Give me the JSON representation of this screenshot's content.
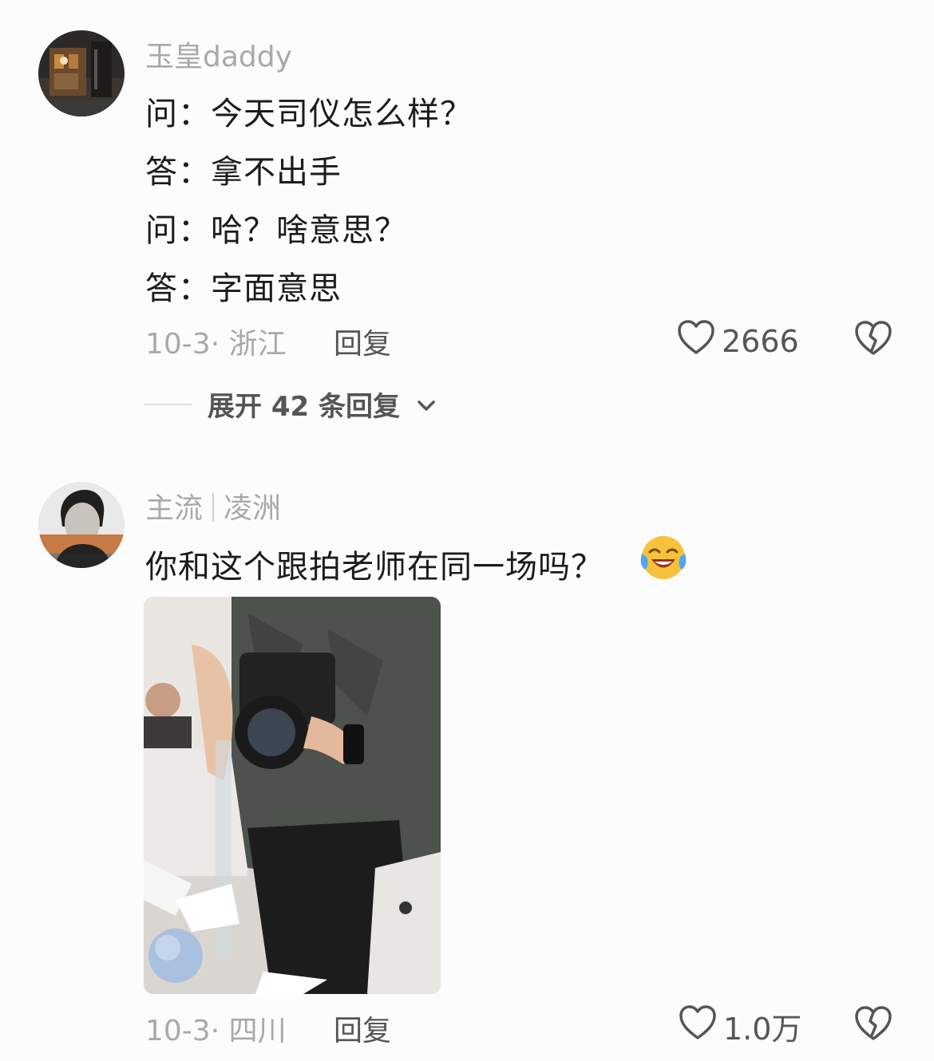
{
  "comments": [
    {
      "username": "玉皇daddy",
      "lines": [
        "问：今天司仪怎么样？",
        "答：拿不出手",
        "问：哈？啥意思？",
        "答：字面意思"
      ],
      "date_location": "10-3· 浙江",
      "reply_label": "回复",
      "like_count": "2666",
      "expand_replies": "展开 42 条回复"
    },
    {
      "username_parts": [
        "主流",
        "凌洲"
      ],
      "text": "你和这个跟拍老师在同一场吗？",
      "date_location": "10-3· 四川",
      "reply_label": "回复",
      "like_count": "1.0万"
    }
  ],
  "icons": {
    "like": "heart-outline-icon",
    "dislike": "broken-heart-icon",
    "expand": "chevron-down-icon",
    "emoji": "laughing-crying-emoji"
  },
  "colors": {
    "background": "#fcfcfc",
    "muted_text": "#a9a9a9",
    "action_text": "#555555"
  }
}
